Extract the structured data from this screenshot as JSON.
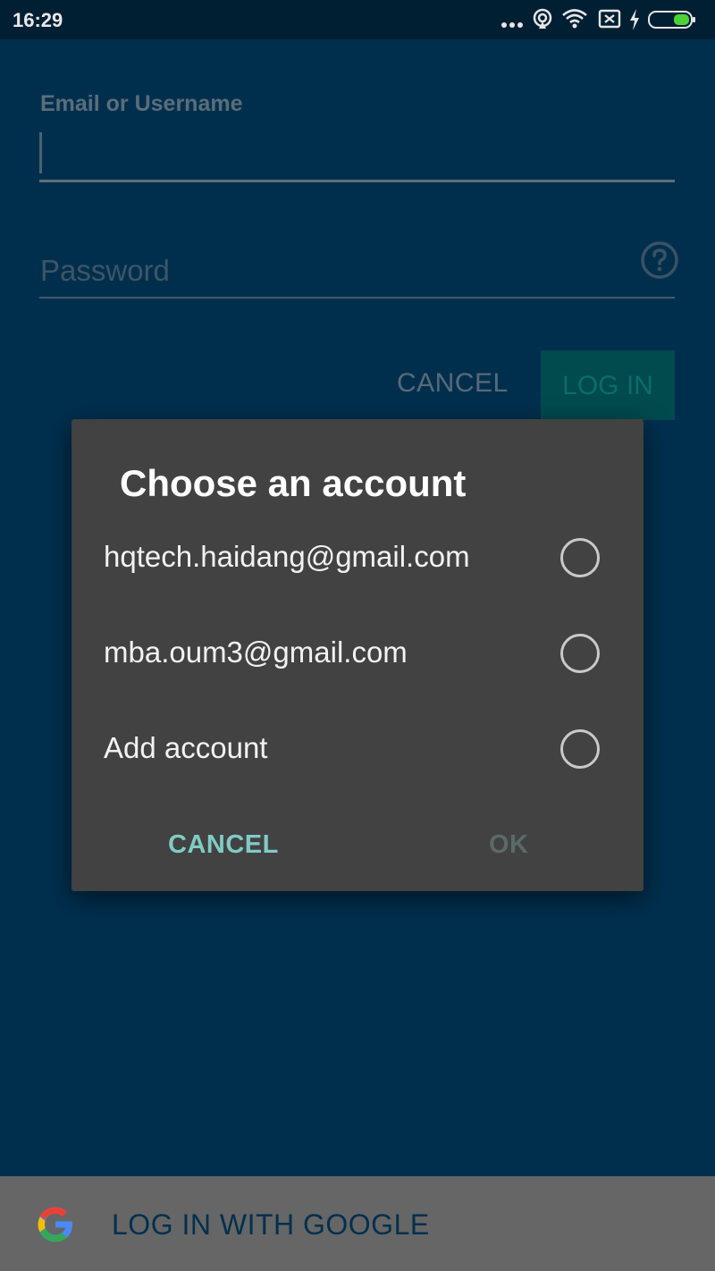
{
  "status_bar": {
    "time": "16:29",
    "icons": [
      "more-dots-icon",
      "hotspot-icon",
      "wifi-icon",
      "no-sim-icon",
      "charging-icon",
      "battery-icon"
    ],
    "battery_color": "#4cd137"
  },
  "login_form": {
    "email_label": "Email or Username",
    "email_value": "",
    "password_placeholder": "Password",
    "help_icon": "question-circle-icon",
    "cancel_label": "CANCEL",
    "login_label": "LOG IN"
  },
  "dialog": {
    "title": "Choose an account",
    "options": [
      {
        "label": "hqtech.haidang@gmail.com",
        "selected": false
      },
      {
        "label": "mba.oum3@gmail.com",
        "selected": false
      },
      {
        "label": "Add account",
        "selected": false
      }
    ],
    "cancel_label": "CANCEL",
    "ok_label": "OK",
    "accent_color": "#80cbc4"
  },
  "google_button": {
    "icon": "google-g-icon",
    "label": "LOG IN WITH GOOGLE"
  }
}
